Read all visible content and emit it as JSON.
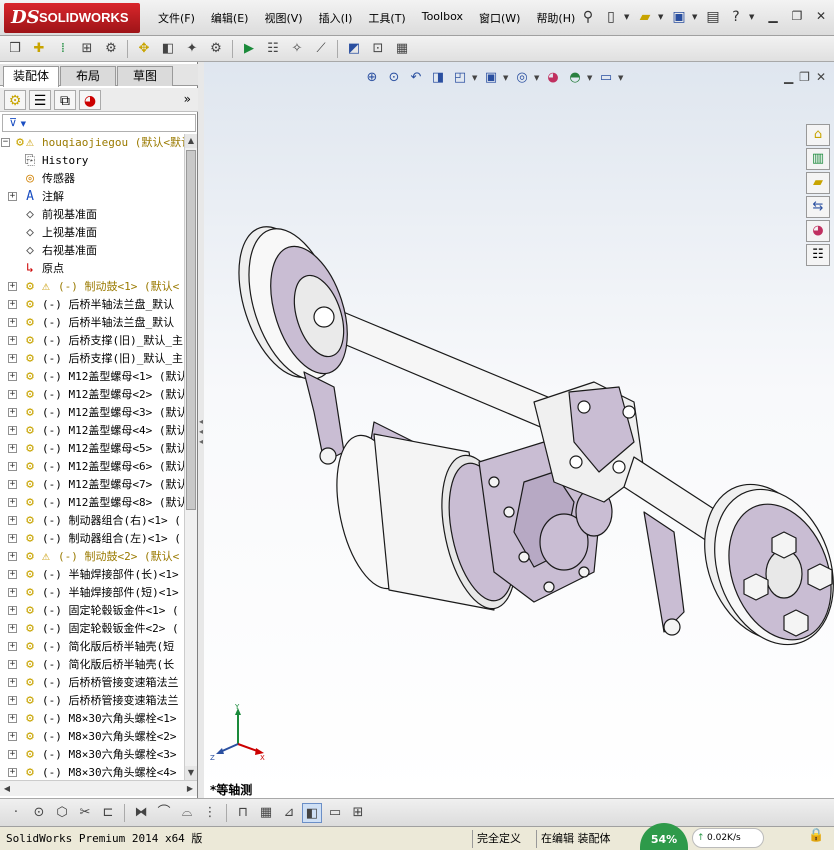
{
  "app": {
    "logo_ds": "DS",
    "logo_name": "SOLIDWORKS",
    "menus": [
      "文件(F)",
      "编辑(E)",
      "视图(V)",
      "插入(I)",
      "工具(T)",
      "Toolbox",
      "窗口(W)",
      "帮助(H)"
    ],
    "quick_icons": [
      "pin-icon",
      "new-doc-icon",
      "open-icon",
      "save-icon",
      "print-icon",
      "help-icon"
    ],
    "window_controls": [
      "minimize-icon",
      "restore-icon",
      "close-icon"
    ]
  },
  "toolbar": {
    "icons": [
      "edit-component-icon",
      "insert-components-icon",
      "mate-icon",
      "component-pattern-icon",
      "smart-fasteners-icon",
      "move-component-icon",
      "show-hidden-icon",
      "assembly-features-icon",
      "reference-geometry-icon",
      "new-motion-study-icon",
      "bill-of-materials-icon",
      "exploded-view-icon",
      "explode-line-icon",
      "interference-check-icon",
      "clearance-icon",
      "hole-alignment-icon"
    ]
  },
  "panel": {
    "tabs": [
      "装配体",
      "布局",
      "草图"
    ],
    "active_tab": "装配体",
    "filter_label": "▼",
    "icons": [
      "feature-manager-icon",
      "property-manager-icon",
      "configuration-manager-icon",
      "display-manager-icon"
    ]
  },
  "tree": {
    "root": {
      "label": "houqiaojiegou  (默认<默认",
      "warning": true
    },
    "items": [
      {
        "label": "History",
        "icon": "history-icon",
        "expand": false
      },
      {
        "label": "传感器",
        "icon": "sensor-icon",
        "expand": false
      },
      {
        "label": "注解",
        "icon": "annotation-icon",
        "expand": true
      },
      {
        "label": "前视基准面",
        "icon": "plane-icon",
        "expand": false
      },
      {
        "label": "上视基准面",
        "icon": "plane-icon",
        "expand": false
      },
      {
        "label": "右视基准面",
        "icon": "plane-icon",
        "expand": false
      },
      {
        "label": "原点",
        "icon": "origin-icon",
        "expand": false
      },
      {
        "label": "(-) 制动鼓<1> (默认<",
        "icon": "subassembly-icon",
        "expand": true,
        "warning": true,
        "gold": true
      },
      {
        "label": "(-) 后桥半轴法兰盘_默认",
        "icon": "part-icon",
        "expand": true
      },
      {
        "label": "(-) 后桥半轴法兰盘_默认",
        "icon": "part-icon",
        "expand": true
      },
      {
        "label": "(-) 后桥支撑(旧)_默认_主",
        "icon": "part-icon",
        "expand": true
      },
      {
        "label": "(-) 后桥支撑(旧)_默认_主",
        "icon": "part-icon",
        "expand": true
      },
      {
        "label": "(-) M12盖型螺母<1> (默认",
        "icon": "part-icon",
        "expand": true
      },
      {
        "label": "(-) M12盖型螺母<2> (默认",
        "icon": "part-icon",
        "expand": true
      },
      {
        "label": "(-) M12盖型螺母<3> (默认",
        "icon": "part-icon",
        "expand": true
      },
      {
        "label": "(-) M12盖型螺母<4> (默认",
        "icon": "part-icon",
        "expand": true
      },
      {
        "label": "(-) M12盖型螺母<5> (默认",
        "icon": "part-icon",
        "expand": true
      },
      {
        "label": "(-) M12盖型螺母<6> (默认",
        "icon": "part-icon",
        "expand": true
      },
      {
        "label": "(-) M12盖型螺母<7> (默认",
        "icon": "part-icon",
        "expand": true
      },
      {
        "label": "(-) M12盖型螺母<8> (默认",
        "icon": "part-icon",
        "expand": true
      },
      {
        "label": "(-) 制动器组合(右)<1> (",
        "icon": "part-icon",
        "expand": true
      },
      {
        "label": "(-) 制动器组合(左)<1> (",
        "icon": "part-icon",
        "expand": true
      },
      {
        "label": "(-) 制动鼓<2> (默认<",
        "icon": "subassembly-icon",
        "expand": true,
        "warning": true,
        "gold": true
      },
      {
        "label": "(-) 半轴焊接部件(长)<1>",
        "icon": "part-icon",
        "expand": true
      },
      {
        "label": "(-) 半轴焊接部件(短)<1>",
        "icon": "part-icon",
        "expand": true
      },
      {
        "label": "(-) 固定轮毂钣金件<1> (",
        "icon": "part-icon",
        "expand": true
      },
      {
        "label": "(-) 固定轮毂钣金件<2> (",
        "icon": "part-icon",
        "expand": true
      },
      {
        "label": "(-) 简化版后桥半轴壳(短",
        "icon": "part-icon",
        "expand": true
      },
      {
        "label": "(-) 简化版后桥半轴壳(长",
        "icon": "part-icon",
        "expand": true
      },
      {
        "label": "(-) 后桥桥管接变速箱法兰",
        "icon": "part-icon",
        "expand": true
      },
      {
        "label": "(-) 后桥桥管接变速箱法兰",
        "icon": "part-icon",
        "expand": true
      },
      {
        "label": "(-) M8×30六角头螺栓<1>",
        "icon": "part-icon",
        "expand": true
      },
      {
        "label": "(-) M8×30六角头螺栓<2>",
        "icon": "part-icon",
        "expand": true
      },
      {
        "label": "(-) M8×30六角头螺栓<3>",
        "icon": "part-icon",
        "expand": true
      },
      {
        "label": "(-) M8×30六角头螺栓<4>",
        "icon": "part-icon",
        "expand": true
      }
    ]
  },
  "viewport": {
    "headsup_icons": [
      "zoom-to-fit-icon",
      "zoom-to-area-icon",
      "previous-view-icon",
      "section-view-icon",
      "view-orientation-icon",
      "display-style-icon",
      "hide-show-items-icon",
      "edit-appearance-icon",
      "apply-scene-icon",
      "view-settings-icon"
    ],
    "window_controls": [
      "minimize-icon",
      "restore-icon",
      "close-icon"
    ],
    "taskpane_icons": [
      "solidworks-resources-icon",
      "design-library-icon",
      "file-explorer-icon",
      "view-palette-icon",
      "appearances-icon",
      "custom-properties-icon"
    ],
    "view_name": "*等轴测",
    "triad": {
      "x": "X",
      "y": "Y",
      "z": "Z"
    },
    "model_colors": {
      "body": "#f2f2f2",
      "accent": "#c9bdd3",
      "outline": "#1a1a1a"
    }
  },
  "bottombar": {
    "icons": [
      "point-icon",
      "circle-icon",
      "polygon-icon",
      "trim-icon",
      "convert-icon",
      "mirror-icon",
      "sketch-fillet-icon",
      "offset-icon",
      "grid-icon",
      "linear-pattern-icon",
      "smart-dimension-icon",
      "isometric-view-icon",
      "front-view-icon",
      "single-view-icon"
    ]
  },
  "status": {
    "app_name": "SolidWorks Premium 2014 x64 版",
    "definition": "完全定义",
    "editing": "在编辑 装配体",
    "net_percent": "54%",
    "net_speed": "0.02K/s"
  }
}
